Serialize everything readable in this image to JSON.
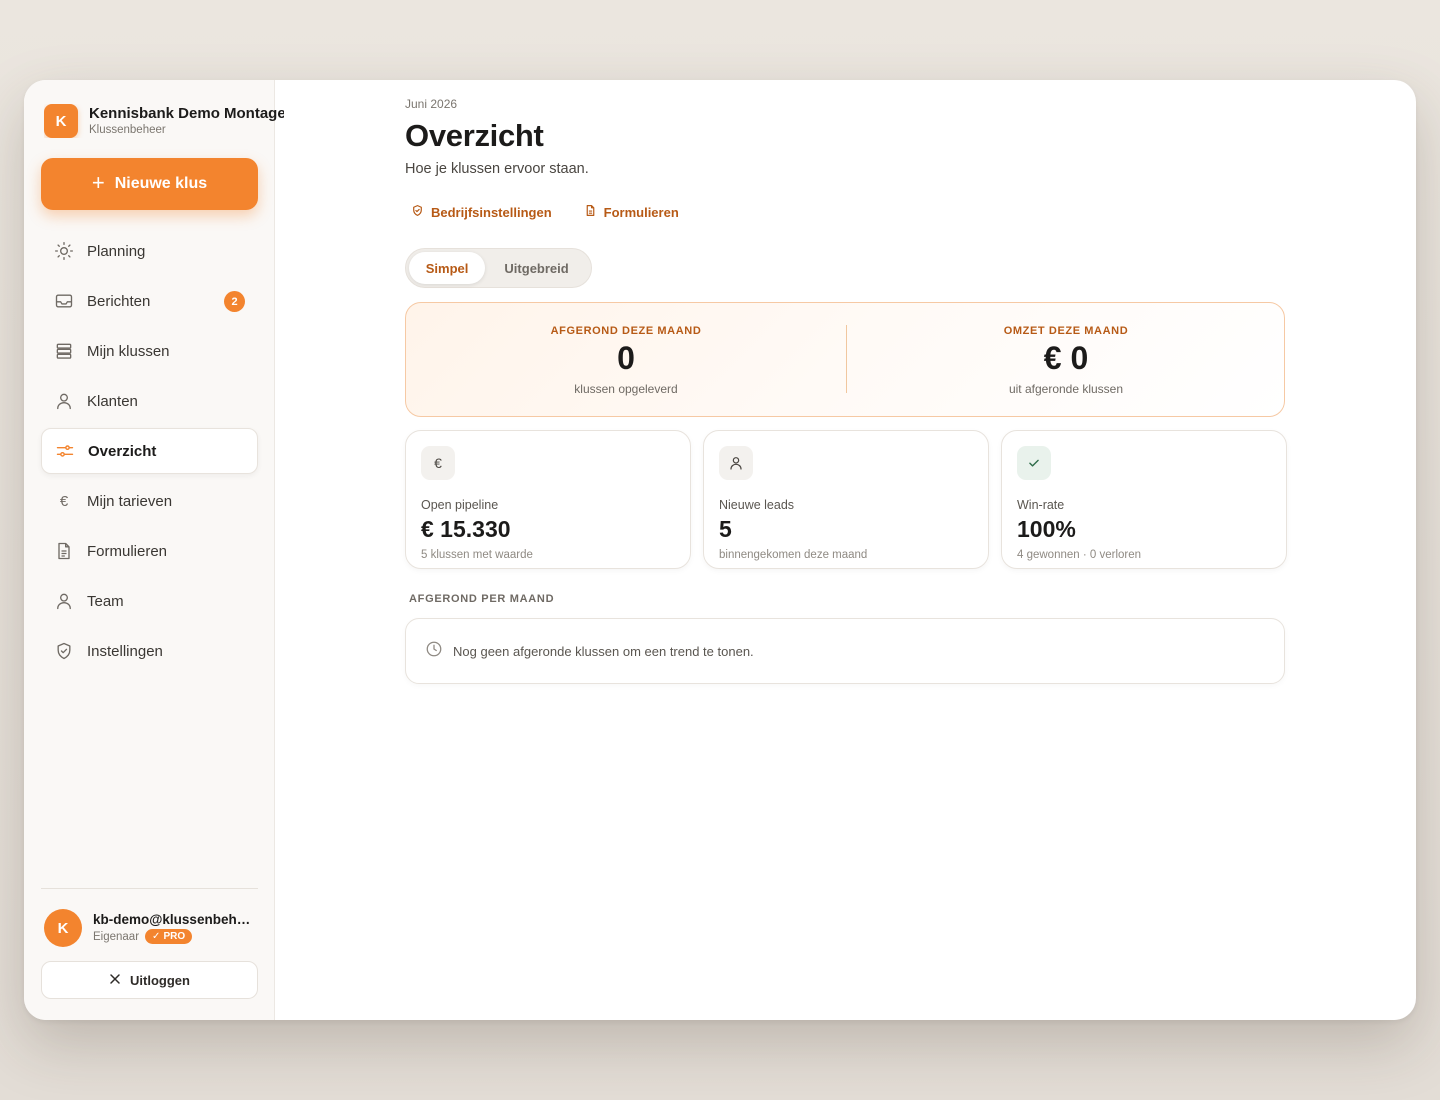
{
  "brand": {
    "initial": "K",
    "name": "Kennisbank Demo Montage",
    "subtitle": "Klussenbeheer"
  },
  "new_button": {
    "label": "Nieuwe klus",
    "icon": "plus-icon"
  },
  "nav": {
    "items": [
      {
        "label": "Planning",
        "icon": "sun-icon"
      },
      {
        "label": "Berichten",
        "icon": "inbox-icon",
        "badge": "2"
      },
      {
        "label": "Mijn klussen",
        "icon": "layers-icon"
      },
      {
        "label": "Klanten",
        "icon": "user-icon"
      },
      {
        "label": "Overzicht",
        "icon": "sliders-icon",
        "active": true
      },
      {
        "label": "Mijn tarieven",
        "icon": "euro-icon"
      },
      {
        "label": "Formulieren",
        "icon": "document-icon"
      },
      {
        "label": "Team",
        "icon": "user-icon"
      },
      {
        "label": "Instellingen",
        "icon": "shield-check-icon"
      }
    ]
  },
  "user": {
    "initial": "K",
    "email": "kb-demo@klussenbeheer.nl",
    "role": "Eigenaar",
    "plan_badge": "PRO"
  },
  "logout": {
    "label": "Uitloggen"
  },
  "header": {
    "date": "Juni 2026",
    "title": "Overzicht",
    "subtitle": "Hoe je klussen ervoor staan."
  },
  "quick_links": [
    {
      "label": "Bedrijfsinstellingen",
      "icon": "shield-check-icon"
    },
    {
      "label": "Formulieren",
      "icon": "document-icon"
    }
  ],
  "view_toggle": {
    "options": [
      "Simpel",
      "Uitgebreid"
    ],
    "selected": "Simpel"
  },
  "hero": {
    "left": {
      "label": "AFGEROND DEZE MAAND",
      "value": "0",
      "sub": "klussen opgeleverd"
    },
    "right": {
      "label": "OMZET DEZE MAAND",
      "value": "€ 0",
      "sub": "uit afgeronde klussen"
    }
  },
  "stats": [
    {
      "icon": "euro-icon",
      "label": "Open pipeline",
      "value": "€ 15.330",
      "sub": "5 klussen met waarde"
    },
    {
      "icon": "user-icon",
      "label": "Nieuwe leads",
      "value": "5",
      "sub": "binnengekomen deze maand"
    },
    {
      "icon": "check-icon",
      "label": "Win-rate",
      "value": "100%",
      "sub": "4 gewonnen · 0 verloren"
    }
  ],
  "trend": {
    "section_label": "AFGEROND PER MAAND",
    "empty_text": "Nog geen afgeronde klussen om een trend te tonen."
  },
  "colors": {
    "accent": "#f3842e",
    "accent_text": "#b75a16"
  }
}
